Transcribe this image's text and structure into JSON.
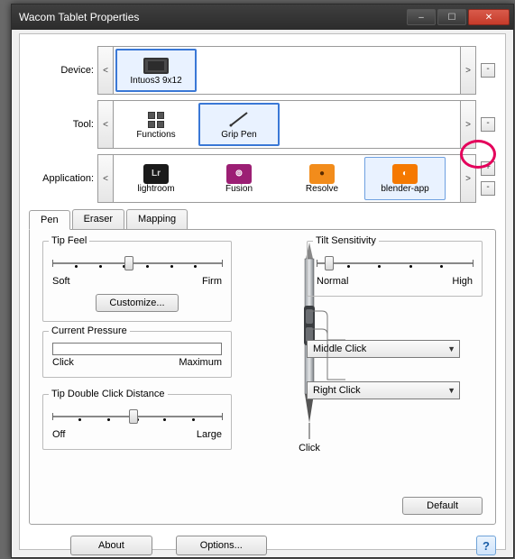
{
  "window": {
    "title": "Wacom Tablet Properties"
  },
  "rows": {
    "device": {
      "label": "Device:",
      "items": [
        {
          "name": "Intuos3 9x12"
        }
      ],
      "selected": 0
    },
    "tool": {
      "label": "Tool:",
      "items": [
        {
          "name": "Functions"
        },
        {
          "name": "Grip Pen"
        }
      ],
      "selected": 1
    },
    "app": {
      "label": "Application:",
      "items": [
        {
          "name": "lightroom",
          "bg": "#1a1a1a",
          "fg": "#d4d4d4",
          "badge": "Lr"
        },
        {
          "name": "Fusion",
          "bg": "#9c1f74",
          "fg": "#ffffff",
          "badge": "⊚"
        },
        {
          "name": "Resolve",
          "bg": "#f28c1b",
          "fg": "#5a2b00",
          "badge": "●"
        },
        {
          "name": "blender-app",
          "bg": "#f57900",
          "fg": "#ffffff",
          "badge": "◐"
        }
      ],
      "selected": 3
    }
  },
  "tabs": [
    "Pen",
    "Eraser",
    "Mapping"
  ],
  "active_tab": 0,
  "pen_tab": {
    "tip_feel": {
      "title": "Tip Feel",
      "min_label": "Soft",
      "max_label": "Firm",
      "value_pct": 45,
      "customize": "Customize..."
    },
    "pressure": {
      "title": "Current Pressure",
      "min_label": "Click",
      "max_label": "Maximum"
    },
    "dbl_click": {
      "title": "Tip Double Click Distance",
      "min_label": "Off",
      "max_label": "Large",
      "value_pct": 48
    },
    "tilt": {
      "title": "Tilt Sensitivity",
      "min_label": "Normal",
      "max_label": "High",
      "value_pct": 8
    },
    "upper_sel": "Middle Click",
    "lower_sel": "Right Click",
    "tip_label": "Click",
    "default_btn": "Default"
  },
  "footer": {
    "about": "About",
    "options": "Options...",
    "help": "?"
  },
  "glyph": {
    "plus": "+",
    "minus": "-",
    "left": "<",
    "right": ">",
    "min": "–",
    "max": "☐",
    "close": "✕",
    "chev": "▼"
  }
}
